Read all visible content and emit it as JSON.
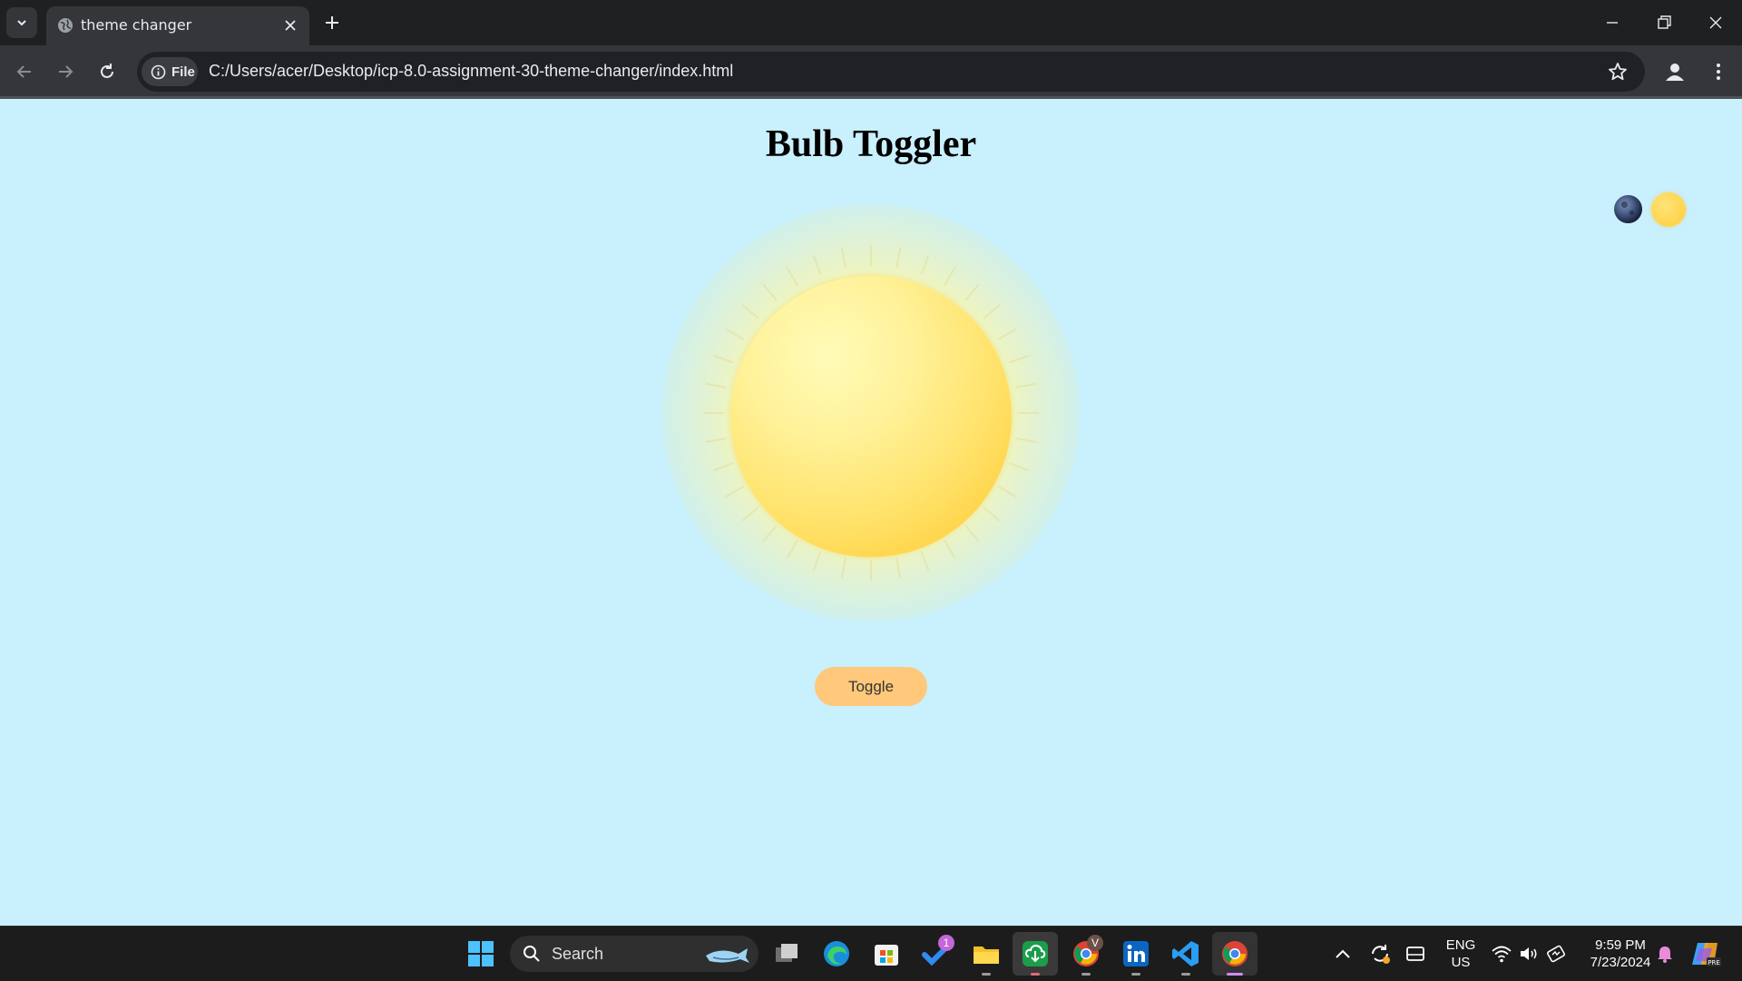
{
  "browser": {
    "tab": {
      "title": "theme changer"
    },
    "address_bar": {
      "scheme_chip": "File",
      "url": "C:/Users/acer/Desktop/icp-8.0-assignment-30-theme-changer/index.html"
    }
  },
  "page": {
    "title": "Bulb Toggler",
    "toggle_button": "Toggle",
    "theme_icons": [
      "moon-icon",
      "sun-icon"
    ],
    "colors": {
      "background": "#c9f0fd",
      "sun": "#ffe26a",
      "toggle_button": "#ffc87a"
    }
  },
  "taskbar": {
    "search_placeholder": "Search",
    "todo_badge": "1",
    "chrome_profile_badge": "V",
    "language": {
      "lang": "ENG",
      "region": "US"
    },
    "clock": {
      "time": "9:59 PM",
      "date": "7/23/2024"
    },
    "apps": [
      "start-icon",
      "search-box",
      "task-view-icon",
      "edge-icon",
      "store-icon",
      "todo-icon",
      "file-explorer-icon",
      "downloader-icon",
      "chrome-profile-icon",
      "linkedin-icon",
      "vscode-icon",
      "chrome-icon"
    ]
  }
}
